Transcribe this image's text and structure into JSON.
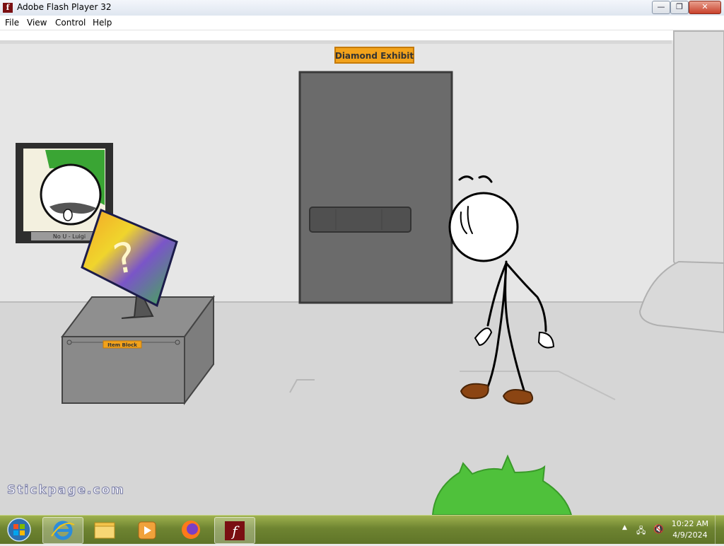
{
  "window": {
    "title": "Adobe Flash Player 32",
    "app_icon": "flash-icon",
    "controls": [
      "minimize-icon",
      "restore-icon",
      "close-icon"
    ],
    "close_glyph": "✕"
  },
  "menu": {
    "items": [
      "File",
      "View",
      "Control",
      "Help"
    ]
  },
  "game": {
    "door_sign": "Diamond Exhibit",
    "portrait_caption": "No U - Luigi",
    "pedestal_label": "Item Block",
    "mystery_glyph": "?",
    "watermark": "Stickpage.com"
  },
  "taskbar": {
    "icons": [
      "windows-start-icon",
      "internet-explorer-icon",
      "file-explorer-icon",
      "media-player-icon",
      "firefox-icon",
      "flash-player-icon"
    ],
    "time": "10:22 AM",
    "date": "4/9/2024",
    "tray_icons": [
      "show-hidden-icon",
      "network-icon",
      "volume-muted-icon"
    ]
  },
  "colors": {
    "flash_red": "#7a0f12",
    "taskbar_green": "#6e8431",
    "sign_orange": "#f2a21b"
  }
}
